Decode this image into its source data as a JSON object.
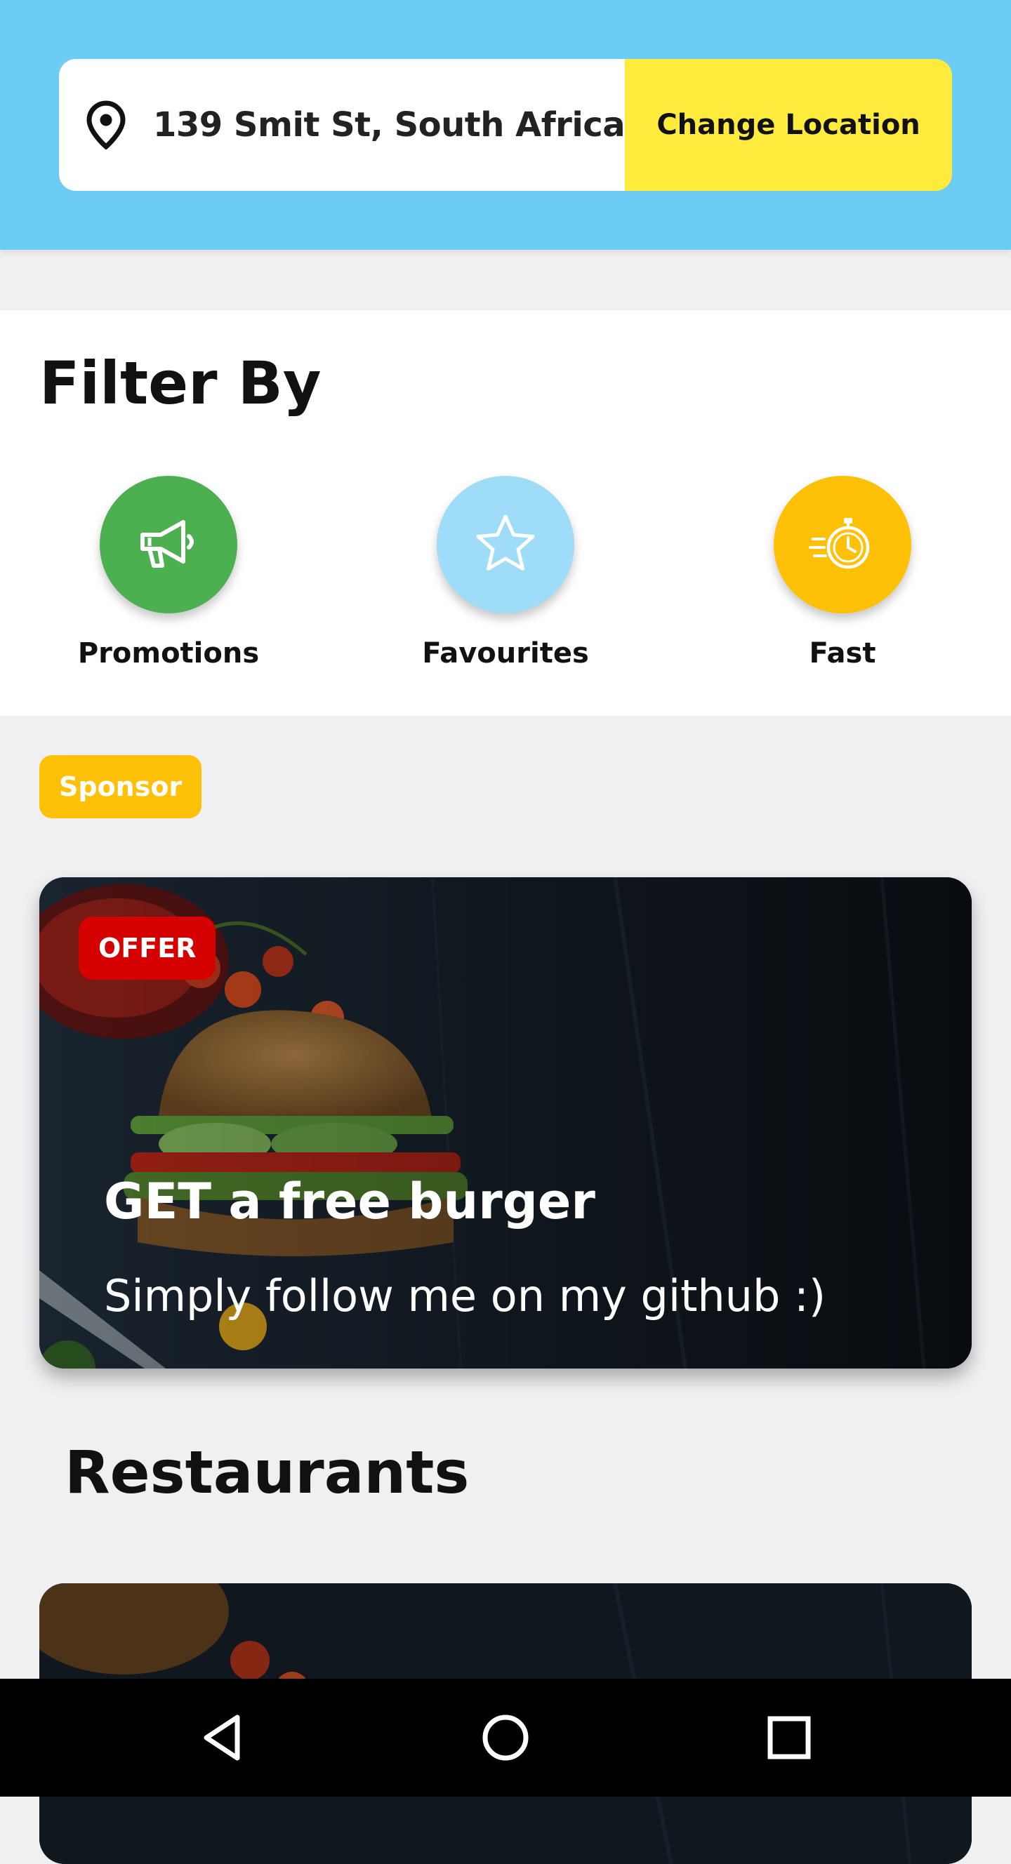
{
  "header": {
    "location_icon": "map-pin-icon",
    "address": "139 Smit St, South Africa",
    "change_location_label": "Change Location",
    "colors": {
      "background": "#6cccf3",
      "button": "#ffeb3b"
    }
  },
  "filter": {
    "title": "Filter By",
    "items": [
      {
        "label": "Promotions",
        "icon": "megaphone-icon",
        "color": "#4caf50"
      },
      {
        "label": "Favourites",
        "icon": "star-icon",
        "color": "#9fdcf7"
      },
      {
        "label": "Fast",
        "icon": "stopwatch-icon",
        "color": "#ffc107"
      }
    ]
  },
  "sponsor": {
    "badge": "Sponsor",
    "color": "#ffc107"
  },
  "promo": {
    "badge": "OFFER",
    "badge_color": "#d50000",
    "title": "GET a free burger",
    "subtitle": "Simply follow me on my github :)"
  },
  "restaurants": {
    "title": "Restaurants"
  },
  "navbar": {
    "buttons": [
      "back-icon",
      "home-icon",
      "recents-icon"
    ]
  }
}
